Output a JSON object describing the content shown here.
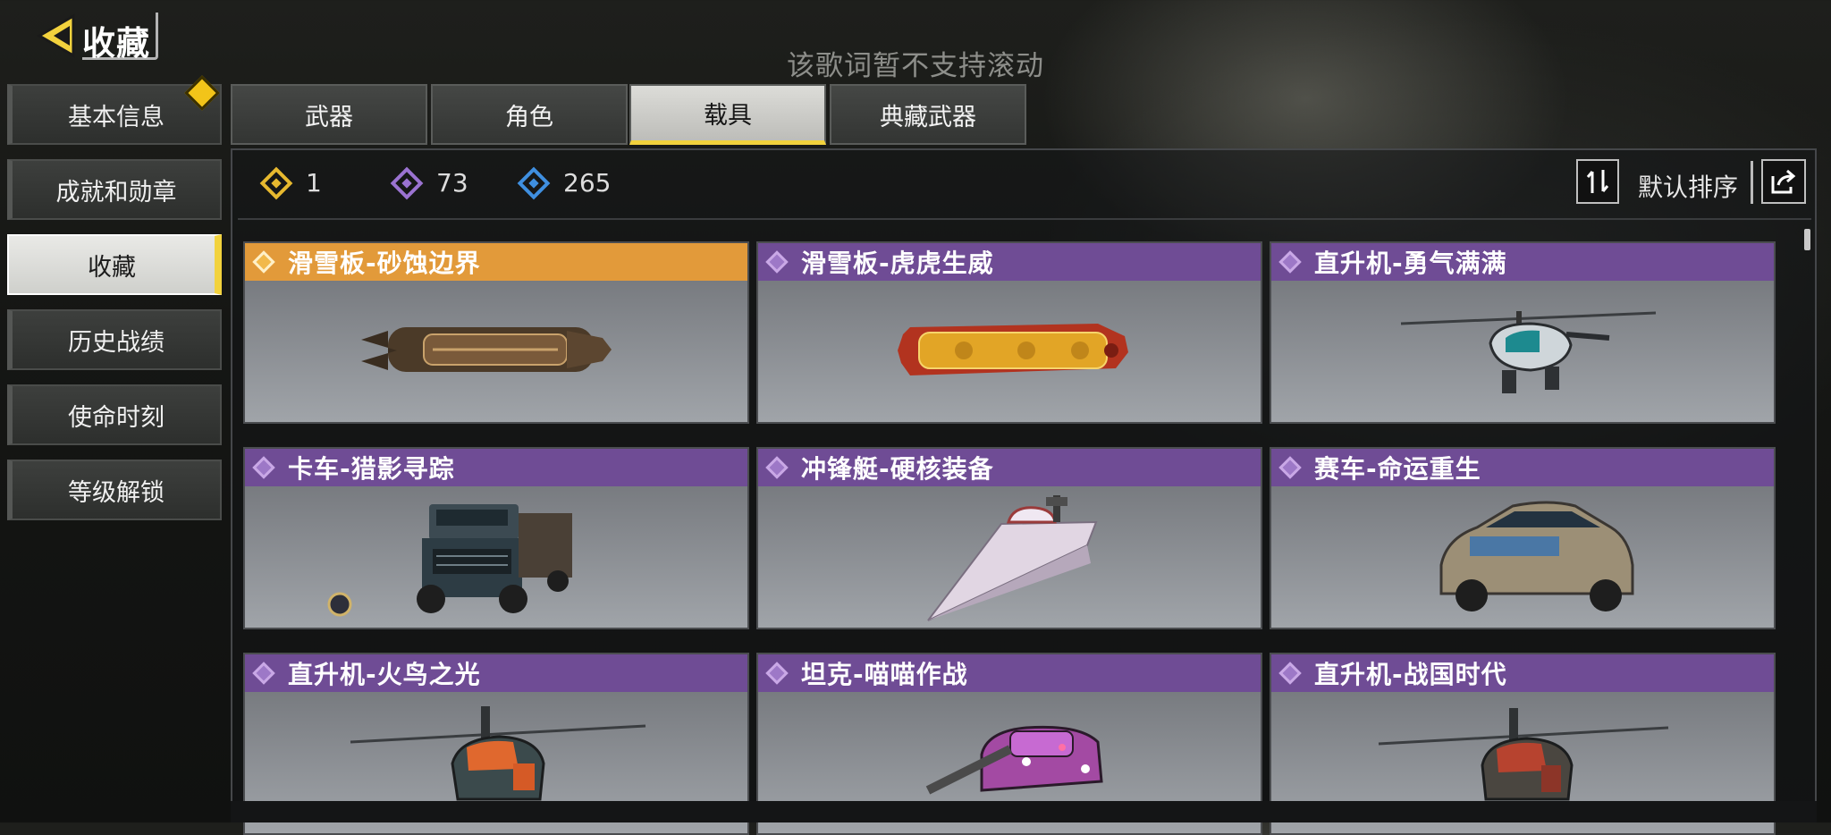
{
  "header": {
    "title": "收藏",
    "lyric_note": "该歌词暂不支持滚动"
  },
  "sidebar": {
    "items": [
      {
        "label": "基本信息"
      },
      {
        "label": "成就和勋章"
      },
      {
        "label": "收藏"
      },
      {
        "label": "历史战绩"
      },
      {
        "label": "使命时刻"
      },
      {
        "label": "等级解锁"
      }
    ],
    "active_index": 2
  },
  "tabs": [
    {
      "label": "武器"
    },
    {
      "label": "角色"
    },
    {
      "label": "载具"
    },
    {
      "label": "典藏武器"
    }
  ],
  "active_tab": 2,
  "counts": [
    {
      "value": "1",
      "color": "#e7b92f"
    },
    {
      "value": "73",
      "color": "#9b73d1"
    },
    {
      "value": "265",
      "color": "#3f8fe0"
    }
  ],
  "sort": {
    "label": "默认排序"
  },
  "items": [
    {
      "name": "滑雪板-砂蚀边界",
      "rarity": "legendary",
      "icon": "snowboard"
    },
    {
      "name": "滑雪板-虎虎生威",
      "rarity": "epic",
      "icon": "snowboard"
    },
    {
      "name": "直升机-勇气满满",
      "rarity": "epic",
      "icon": "helicopter"
    },
    {
      "name": "卡车-猎影寻踪",
      "rarity": "epic",
      "icon": "truck"
    },
    {
      "name": "冲锋艇-硬核装备",
      "rarity": "epic",
      "icon": "boat"
    },
    {
      "name": "赛车-命运重生",
      "rarity": "epic",
      "icon": "race-car"
    },
    {
      "name": "直升机-火鸟之光",
      "rarity": "epic",
      "icon": "helicopter"
    },
    {
      "name": "坦克-喵喵作战",
      "rarity": "epic",
      "icon": "tank"
    },
    {
      "name": "直升机-战国时代",
      "rarity": "epic",
      "icon": "helicopter"
    }
  ],
  "colors": {
    "accent": "#f2d23d",
    "epic": "#6f4c95",
    "legendary": "#e29a3a"
  }
}
